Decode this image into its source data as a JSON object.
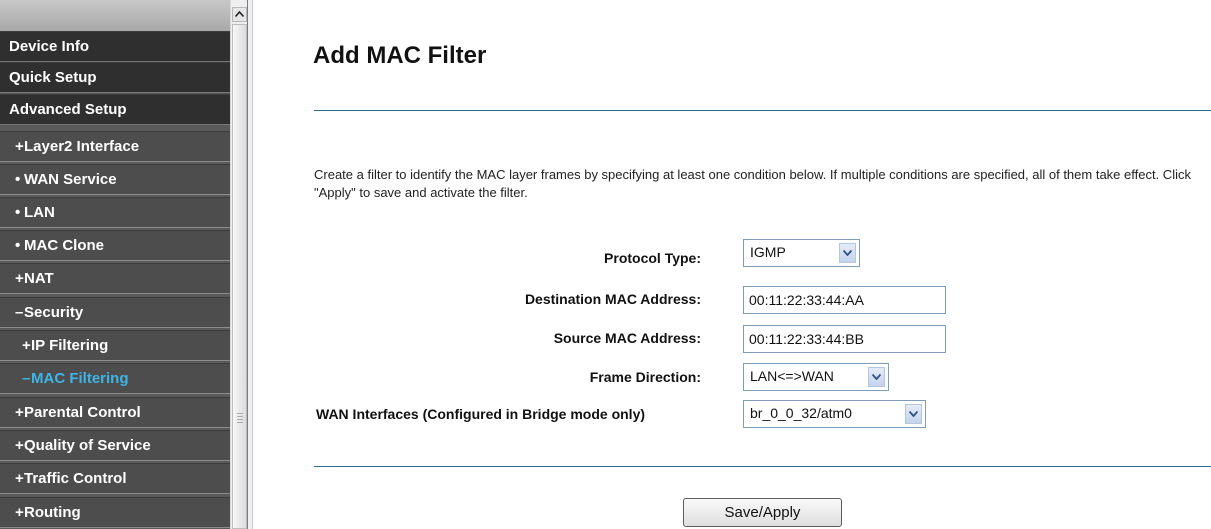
{
  "sidebar": {
    "items": [
      {
        "marker": "",
        "label": "Device Info"
      },
      {
        "marker": "",
        "label": "Quick Setup"
      },
      {
        "marker": "",
        "label": "Advanced Setup"
      },
      {
        "marker": "+",
        "label": "Layer2 Interface"
      },
      {
        "marker": "•",
        "label": "WAN Service"
      },
      {
        "marker": "•",
        "label": "LAN"
      },
      {
        "marker": "•",
        "label": "MAC Clone"
      },
      {
        "marker": "+",
        "label": "NAT"
      },
      {
        "marker": "–",
        "label": "Security"
      },
      {
        "marker": "+",
        "label": "IP Filtering"
      },
      {
        "marker": "–",
        "label": "MAC Filtering"
      },
      {
        "marker": "+",
        "label": "Parental Control"
      },
      {
        "marker": "+",
        "label": "Quality of Service"
      },
      {
        "marker": "+",
        "label": "Traffic Control"
      },
      {
        "marker": "+",
        "label": "Routing"
      }
    ],
    "active_item": "MAC Filtering",
    "active_color": "#3fb4e6"
  },
  "main": {
    "title": "Add MAC Filter",
    "description": "Create a filter to identify the MAC layer frames by specifying at least one condition below. If multiple conditions are specified, all of them take effect. Click \"Apply\" to save and activate the filter.",
    "form": {
      "protocol_type": {
        "label": "Protocol Type:",
        "value": "IGMP"
      },
      "destination_mac": {
        "label": "Destination MAC Address:",
        "value": "00:11:22:33:44:AA"
      },
      "source_mac": {
        "label": "Source MAC Address:",
        "value": "00:11:22:33:44:BB"
      },
      "frame_direction": {
        "label": "Frame Direction:",
        "value": "LAN<=>WAN"
      },
      "wan_interfaces": {
        "label": "WAN Interfaces (Configured in Bridge mode only)",
        "value": "br_0_0_32/atm0"
      }
    },
    "save_label": "Save/Apply"
  },
  "colors": {
    "sidebar_bg": "#4d4d4d",
    "divider_line": "#2c6d8a",
    "dropdown_arrow": "#2e4f87"
  }
}
